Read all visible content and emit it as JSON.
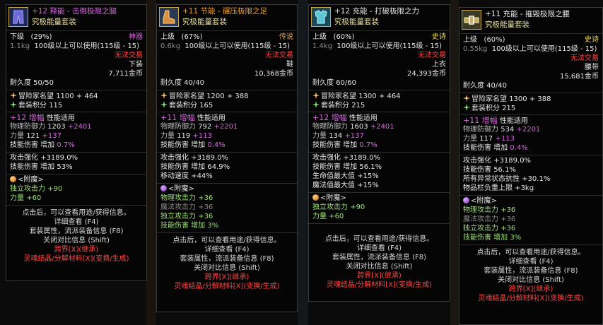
{
  "cards": [
    {
      "title": "+12 释能 - 击倒极限之腿",
      "set_name": "究极能量套装",
      "grade": "下级",
      "grade_pct": "(29%)",
      "rarity": "神器",
      "rarity_color": "#d16ad8",
      "weight": "1.1kg",
      "level_req": "100级以上可以使用(115级 - 15)",
      "no_trade": "无法交易",
      "slot": "下装",
      "price": "7,711金币",
      "durability": "耐久度 50/50",
      "fame_label": "冒险家名望",
      "fame_value": "1100 + 464",
      "set_points_label": "套装积分",
      "set_points_value": "115",
      "amplify": "+12 增幅",
      "amplify_tail": "性能适用",
      "stats_a": [
        {
          "label": "物理防御力",
          "value": "1203",
          "bonus": "+2401"
        },
        {
          "label": "力量",
          "value": "121",
          "bonus": "+137"
        },
        {
          "label": "技能伤害  增加",
          "value": "",
          "bonus": "0.7%"
        }
      ],
      "stats_b": [
        {
          "label": "攻击强化",
          "value": "+3189.0%"
        },
        {
          "label": "技能伤害  增加",
          "value": "53%"
        }
      ],
      "enchant_title": "<附魔>",
      "enchant": [
        {
          "label": "独立攻击力",
          "value": "+90",
          "dim": false
        },
        {
          "label": "力量",
          "value": "+60",
          "dim": false
        }
      ],
      "footer": [
        "点击后，可以查看用途/获得信息。",
        "详细查看 (F4)",
        "套装属性，流派装备信息 (F8)",
        "关闭对比信息 (Shift)",
        "跨界[X](继承)",
        "灵魂结晶/分解材料[X](变换/生成)"
      ]
    },
    {
      "title": "+11 节能 - 碾压极限之足",
      "set_name": "究极能量套装",
      "grade": "上级",
      "grade_pct": "(67%)",
      "rarity": "传说",
      "rarity_color": "#f0a030",
      "weight": "0.6kg",
      "level_req": "100级以上可以使用(115级 - 15)",
      "no_trade": "无法交易",
      "slot": "鞋",
      "price": "10,368金币",
      "durability": "耐久度 40/40",
      "fame_label": "冒险家名望",
      "fame_value": "1200 + 388",
      "set_points_label": "套装积分",
      "set_points_value": "165",
      "amplify": "+11 增幅",
      "amplify_tail": "性能适用",
      "stats_a": [
        {
          "label": "物理防御力",
          "value": "792",
          "bonus": "+2201"
        },
        {
          "label": "力量",
          "value": "119",
          "bonus": "+113"
        },
        {
          "label": "技能伤害  增加",
          "value": "",
          "bonus": "0.4%"
        }
      ],
      "stats_b": [
        {
          "label": "攻击强化",
          "value": "+3189.0%"
        },
        {
          "label": "技能伤害  增加",
          "value": "64.9%"
        },
        {
          "label": "移动速度",
          "value": "+44%"
        }
      ],
      "enchant_title": "<附魔>",
      "enchant": [
        {
          "label": "物理攻击力",
          "value": "+36",
          "dim": false
        },
        {
          "label": "魔法攻击力",
          "value": "+36",
          "dim": true
        },
        {
          "label": "独立攻击力",
          "value": "+36",
          "dim": false
        },
        {
          "label": "技能伤害  增加",
          "value": "3%",
          "dim": false
        }
      ],
      "footer": [
        "点击后，可以查看用途/获得信息。",
        "详细查看 (F4)",
        "套装属性，流派装备信息 (F8)",
        "关闭对比信息 (Shift)",
        "跨界[X](继承)",
        "灵魂结晶/分解材料[X](变换/生成)"
      ]
    },
    {
      "title": "+12 充能 - 打破极限之力",
      "set_name": "究极能量套装",
      "grade": "上级",
      "grade_pct": "(60%)",
      "rarity": "史诗",
      "rarity_color": "#f0dc4c",
      "weight": "1.4kg",
      "level_req": "100级以上可以使用(115级 - 15)",
      "no_trade": "无法交易",
      "slot": "上衣",
      "price": "24,393金币",
      "durability": "耐久度 60/60",
      "fame_label": "冒险家名望",
      "fame_value": "1300 + 464",
      "set_points_label": "套装积分",
      "set_points_value": "215",
      "amplify": "+12 增幅",
      "amplify_tail": "性能适用",
      "stats_a": [
        {
          "label": "物理防御力",
          "value": "1603",
          "bonus": "+2401"
        },
        {
          "label": "力量",
          "value": "134",
          "bonus": "+137"
        },
        {
          "label": "技能伤害  增加",
          "value": "",
          "bonus": "0.7%"
        }
      ],
      "stats_b": [
        {
          "label": "攻击强化",
          "value": "+3189.0%"
        },
        {
          "label": "技能伤害  增加",
          "value": "56.1%"
        },
        {
          "label": "生命值最大值",
          "value": "+15%"
        },
        {
          "label": "魔法值最大值",
          "value": "+15%"
        }
      ],
      "enchant_title": "<附魔>",
      "enchant": [
        {
          "label": "独立攻击力",
          "value": "+90",
          "dim": false
        },
        {
          "label": "力量",
          "value": "+60",
          "dim": false
        }
      ],
      "footer": [
        "点击后，可以查看用途/获得信息。",
        "详细查看 (F4)",
        "套装属性，流派装备信息 (F8)",
        "关闭对比信息 (Shift)",
        "跨界[X](继承)",
        "灵魂结晶/分解材料[X](变换/生成)"
      ]
    },
    {
      "title": "+11 充能 - 摧毁极限之腰",
      "set_name": "究极能量套装",
      "grade": "上级",
      "grade_pct": "(60%)",
      "rarity": "史诗",
      "rarity_color": "#f0dc4c",
      "weight": "0.55kg",
      "level_req": "100级以上可以使用(115级 - 15)",
      "no_trade": "无法交易",
      "slot": "腰带",
      "price": "15,681金币",
      "durability": "耐久度 40/40",
      "fame_label": "冒险家名望",
      "fame_value": "1300 + 388",
      "set_points_label": "套装积分",
      "set_points_value": "215",
      "amplify": "+11 增幅",
      "amplify_tail": "性能适用",
      "stats_a": [
        {
          "label": "物理防御力",
          "value": "534",
          "bonus": "+2201"
        },
        {
          "label": "力量",
          "value": "117",
          "bonus": "+113"
        },
        {
          "label": "技能伤害  增加",
          "value": "",
          "bonus": "0.4%"
        }
      ],
      "stats_b": [
        {
          "label": "攻击强化",
          "value": "+3189.0%"
        },
        {
          "label": "技能伤害",
          "value": "56.1%"
        },
        {
          "label": "所有异常状态抗性",
          "value": "+30.1%"
        },
        {
          "label": "物品栏负重上限",
          "value": "+3kg"
        }
      ],
      "enchant_title": "<附魔>",
      "enchant": [
        {
          "label": "物理攻击力",
          "value": "+36",
          "dim": false
        },
        {
          "label": "魔法攻击力",
          "value": "+36",
          "dim": true
        },
        {
          "label": "独立攻击力",
          "value": "+36",
          "dim": false
        },
        {
          "label": "技能伤害  增加",
          "value": "3%",
          "dim": false
        }
      ],
      "footer": [
        "点击后，可以查看用途/获得信息。",
        "详细查看 (F4)",
        "套装属性，流派装备信息 (F8)",
        "关闭对比信息 (Shift)",
        "跨界[X](继承)",
        "灵魂结晶/分解材料[X](变换/生成)"
      ]
    }
  ]
}
